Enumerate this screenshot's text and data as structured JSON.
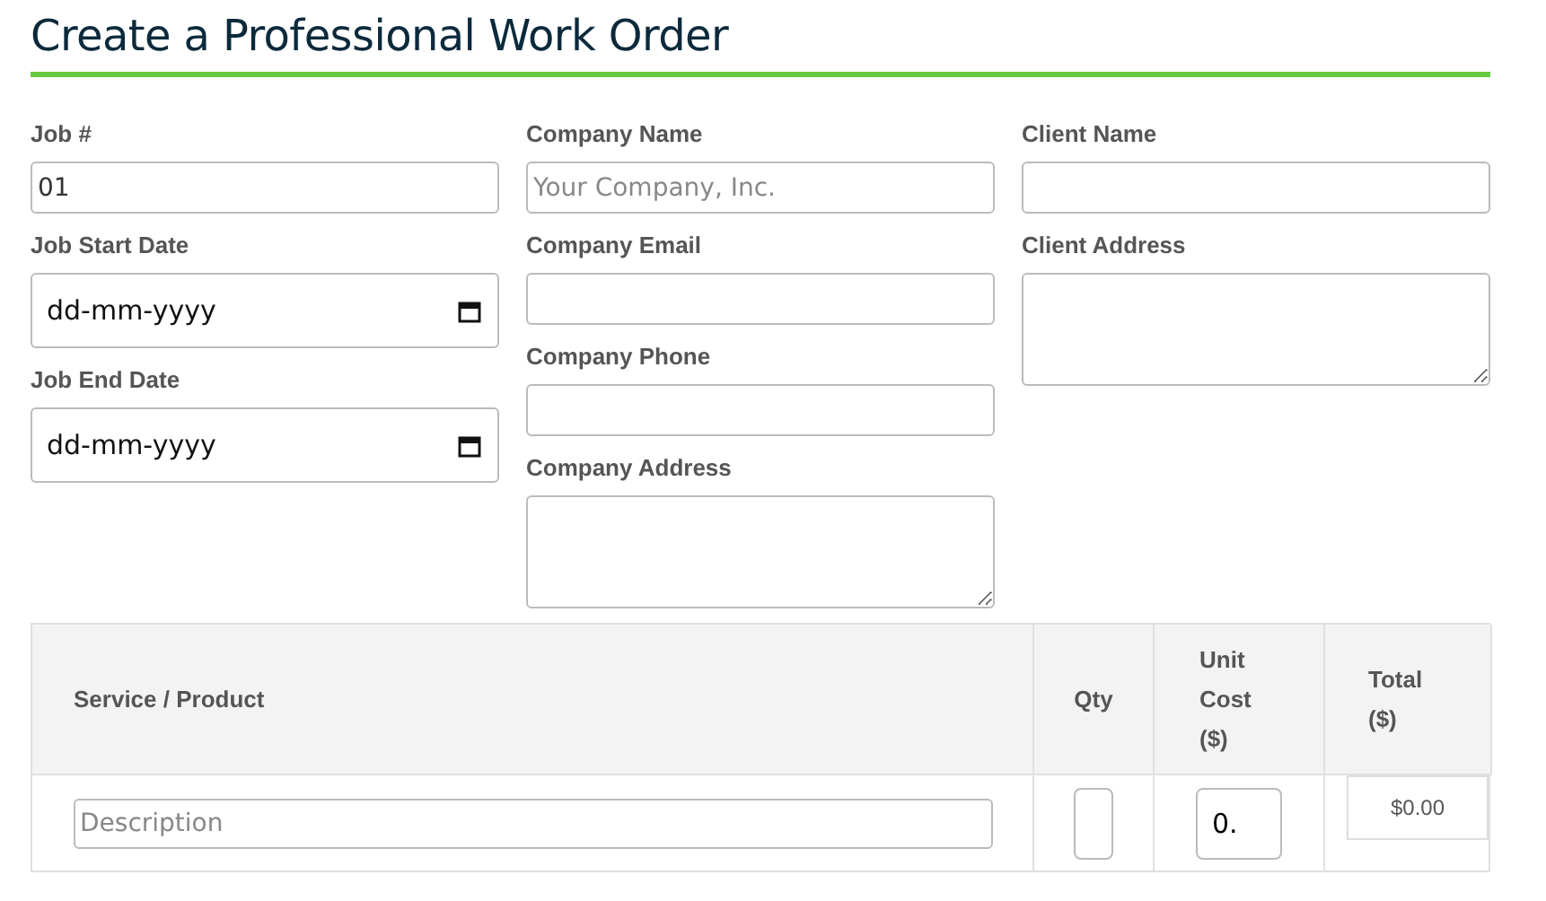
{
  "title": "Create a Professional Work Order",
  "columns": [
    [
      {
        "label": "Job #",
        "kind": "text",
        "value": "01"
      },
      {
        "label": "Job Start Date",
        "kind": "date",
        "value": "dd-mm-yyyy"
      },
      {
        "label": "Job End Date",
        "kind": "date",
        "value": "dd-mm-yyyy"
      }
    ],
    [
      {
        "label": "Company Name",
        "kind": "text",
        "placeholder": "Your Company, Inc."
      },
      {
        "label": "Company Email",
        "kind": "text"
      },
      {
        "label": "Company Phone",
        "kind": "text"
      },
      {
        "label": "Company Address",
        "kind": "textarea"
      }
    ],
    [
      {
        "label": "Client Name",
        "kind": "text"
      },
      {
        "label": "Client Address",
        "kind": "textarea"
      }
    ]
  ],
  "table": {
    "columns": [
      "Service / Product",
      "Qty",
      "Unit Cost ($)",
      "Total ($)"
    ],
    "rows": [
      {
        "description_placeholder": "Description",
        "qty": "",
        "unit_cost": "0.",
        "total": "$0.00"
      }
    ]
  }
}
